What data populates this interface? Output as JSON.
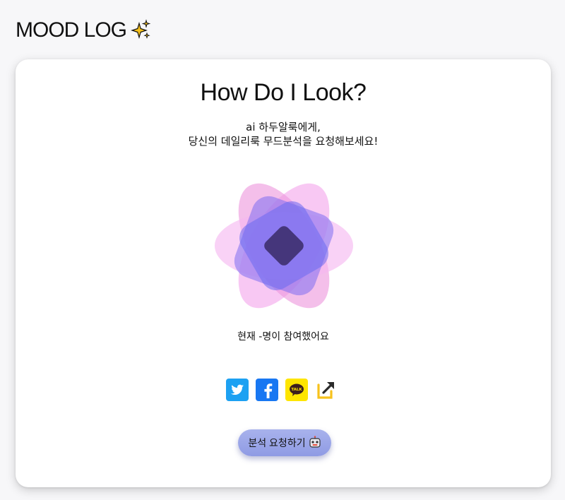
{
  "header": {
    "title": "MOOD LOG",
    "icon": "sparkles-icon"
  },
  "card": {
    "title": "How Do I Look?",
    "subtitle_line1": "ai 하두알룩에게,",
    "subtitle_line2": "당신의 데일리룩 무드분석을 요청해보세요!",
    "participants": "현재 -명이 참여했어요",
    "share": {
      "items": [
        {
          "name": "twitter-share-icon"
        },
        {
          "name": "facebook-share-icon"
        },
        {
          "name": "kakao-share-icon",
          "label": "TALK"
        },
        {
          "name": "link-share-icon"
        }
      ]
    },
    "request_button_label": "분석 요청하기",
    "request_button_icon": "robot-face-icon"
  },
  "colors": {
    "pink": "#f3a6ec",
    "violet": "#8d7ff0",
    "button": "#9aa5e8"
  }
}
